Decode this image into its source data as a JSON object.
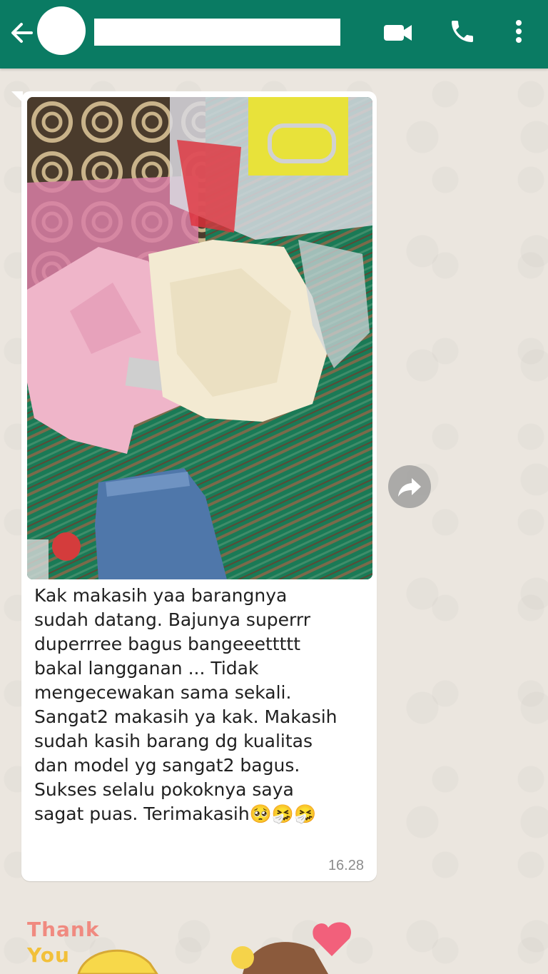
{
  "header": {
    "back_icon": "arrow-left-icon",
    "video_icon": "video-camera-icon",
    "call_icon": "phone-icon",
    "menu_icon": "more-vertical-icon",
    "color": "#0a7b63"
  },
  "message": {
    "caption": "Kak makasih yaa barangnya\nsudah datang. Bajunya superrr\nduperrree bagus bangeeettttt\nbakal langganan ... Tidak\nmengecewakan sama sekali.\nSangat2 makasih ya kak. Makasih\nsudah kasih barang dg kualitas\ndan model yg sangat2 bagus.\nSukses selalu pokoknya saya\nsagat puas. Terimakasih🥺🤧🤧",
    "time": "16.28",
    "forward_icon": "forward-icon"
  },
  "sticker": {
    "line1": "Thank",
    "line2": "You"
  }
}
